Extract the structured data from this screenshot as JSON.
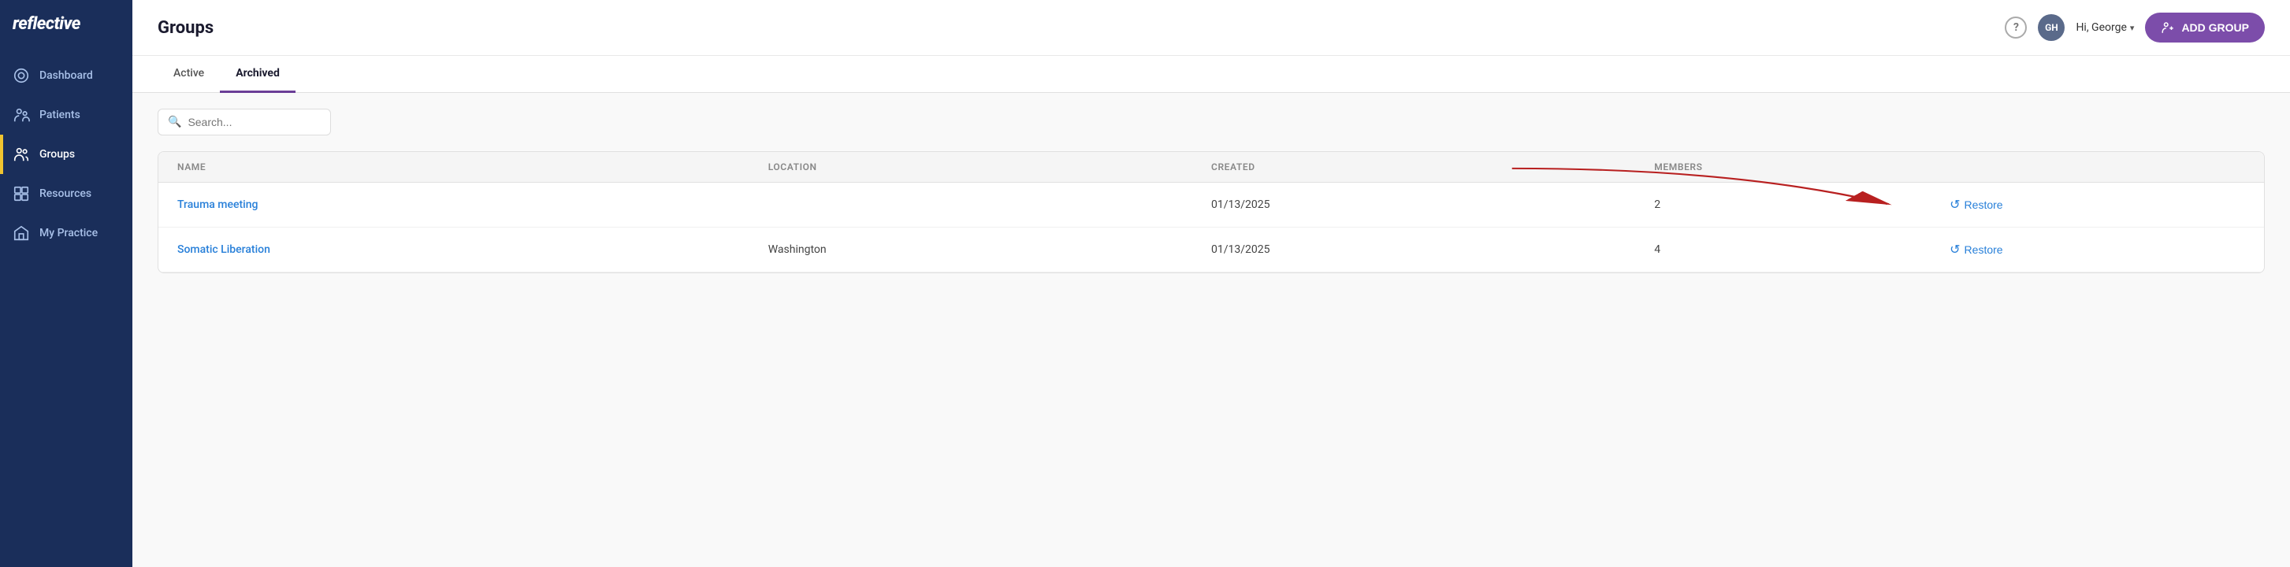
{
  "app": {
    "name": "reflective"
  },
  "sidebar": {
    "items": [
      {
        "id": "dashboard",
        "label": "Dashboard",
        "active": false
      },
      {
        "id": "patients",
        "label": "Patients",
        "active": false
      },
      {
        "id": "groups",
        "label": "Groups",
        "active": true
      },
      {
        "id": "resources",
        "label": "Resources",
        "active": false
      },
      {
        "id": "my-practice",
        "label": "My Practice",
        "active": false
      }
    ]
  },
  "header": {
    "title": "Groups",
    "user": {
      "initials": "GH",
      "greeting": "Hi, George"
    },
    "add_group_label": "ADD GROUP",
    "help_label": "?"
  },
  "tabs": [
    {
      "id": "active",
      "label": "Active",
      "active": false
    },
    {
      "id": "archived",
      "label": "Archived",
      "active": true
    }
  ],
  "search": {
    "placeholder": "Search..."
  },
  "table": {
    "columns": [
      "NAME",
      "LOCATION",
      "CREATED",
      "MEMBERS",
      ""
    ],
    "rows": [
      {
        "name": "Trauma meeting",
        "location": "",
        "created": "01/13/2025",
        "members": "2",
        "action": "Restore"
      },
      {
        "name": "Somatic Liberation",
        "location": "Washington",
        "created": "01/13/2025",
        "members": "4",
        "action": "Restore"
      }
    ]
  },
  "icons": {
    "dashboard": "⊙",
    "patients": "👤",
    "groups": "👥",
    "resources": "📋",
    "my_practice": "🏢",
    "restore": "↺",
    "add_group": "👥",
    "search": "🔍",
    "help": "?",
    "chevron_down": "▾"
  },
  "colors": {
    "sidebar_bg": "#1a2e5a",
    "accent_purple": "#7c4daa",
    "active_yellow": "#f0c430",
    "link_blue": "#2980d9",
    "arrow_red": "#b82020"
  }
}
